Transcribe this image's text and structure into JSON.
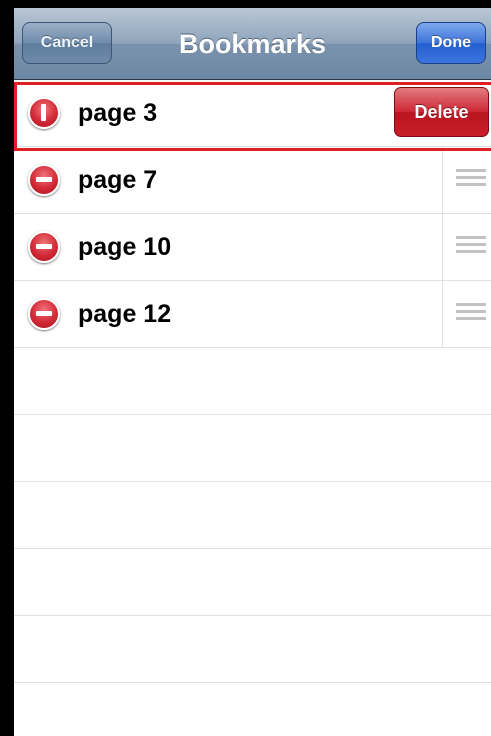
{
  "navbar": {
    "title": "Bookmarks",
    "cancel_label": "Cancel",
    "done_label": "Done"
  },
  "bookmarks": [
    {
      "label": "page 3",
      "delete_label": "Delete",
      "state": "delete-confirm"
    },
    {
      "label": "page 7"
    },
    {
      "label": "page 10"
    },
    {
      "label": "page 12"
    }
  ],
  "colors": {
    "delete": "#c81e2a",
    "highlight": "#e02020",
    "done": "#2660d0"
  }
}
